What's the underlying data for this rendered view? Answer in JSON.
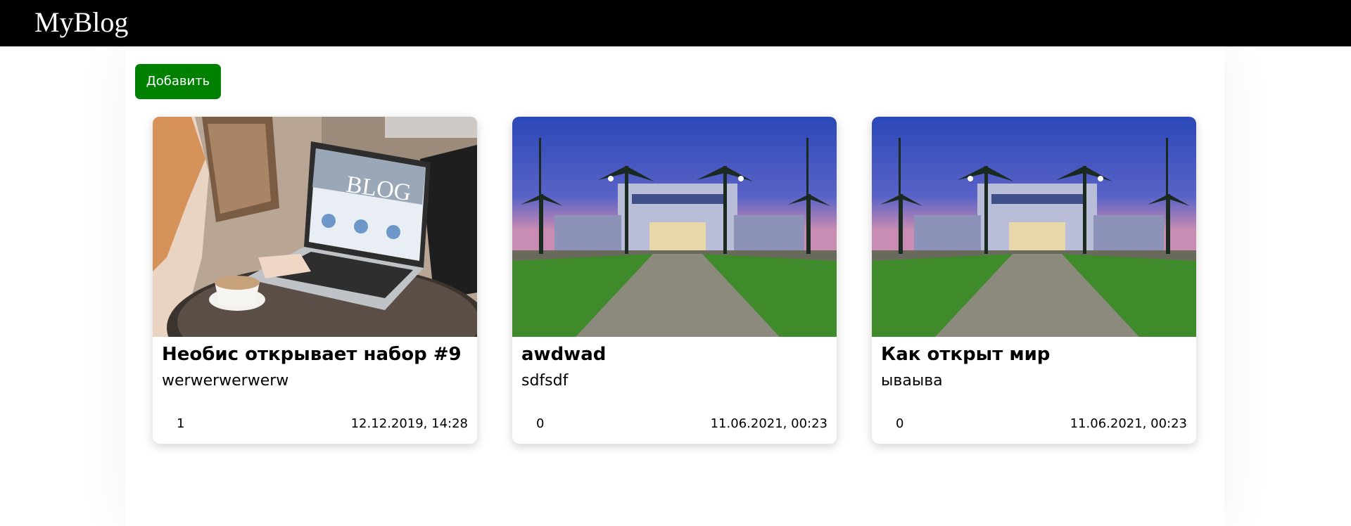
{
  "header": {
    "brand": "MyBlog"
  },
  "toolbar": {
    "add_label": "Добавить"
  },
  "colors": {
    "header_bg": "#000000",
    "add_button": "#008000"
  },
  "posts": [
    {
      "title": "Необис открывает набор #9",
      "text": "werwerwerwerw",
      "count": "1",
      "date": "12.12.2019, 14:28",
      "image": "laptop-blog-photo"
    },
    {
      "title": "awdwad",
      "text": "sdfsdf",
      "count": "0",
      "date": "11.06.2021, 00:23",
      "image": "stadium-night-photo"
    },
    {
      "title": "Как открыт мир",
      "text": "ываыва",
      "count": "0",
      "date": "11.06.2021, 00:23",
      "image": "stadium-night-photo"
    }
  ]
}
